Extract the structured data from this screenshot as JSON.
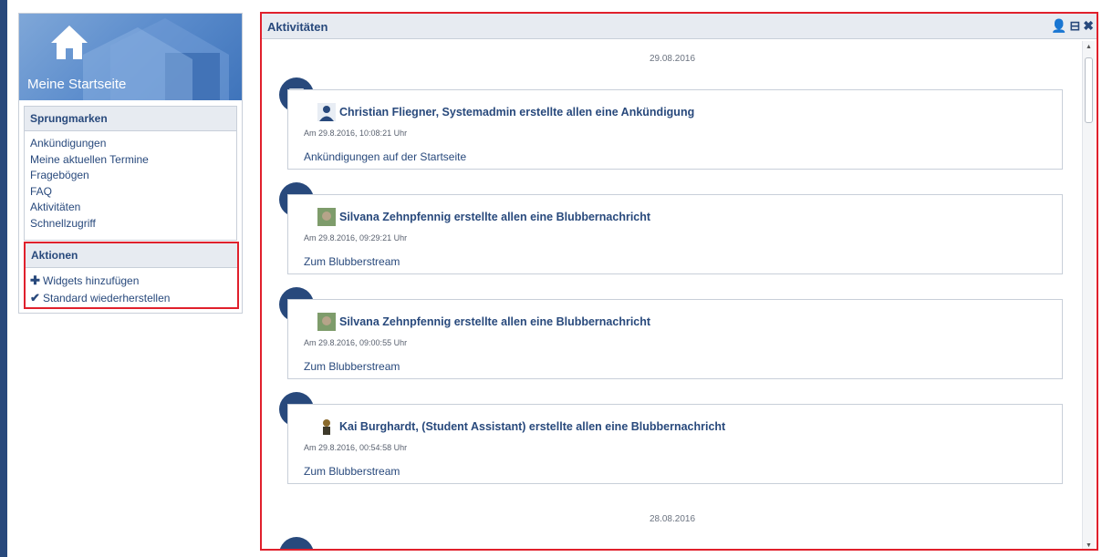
{
  "sidebar": {
    "title": "Meine Startseite",
    "jump": {
      "header": "Sprungmarken",
      "items": [
        "Ankündigungen",
        "Meine aktuellen Termine",
        "Fragebögen",
        "FAQ",
        "Aktivitäten",
        "Schnellzugriff"
      ]
    },
    "actions": {
      "header": "Aktionen",
      "items": [
        "Widgets hinzufügen",
        "Standard wiederherstellen"
      ]
    }
  },
  "main": {
    "title": "Aktivitäten",
    "dates": [
      "29.08.2016",
      "28.08.2016"
    ],
    "activities": [
      {
        "who": "Christian Fliegner, Systemadmin erstellte allen eine Ankündigung",
        "time": "Am 29.8.2016, 10:08:21 Uhr",
        "link": "Ankündigungen auf der Startseite",
        "icon": "announcement-icon"
      },
      {
        "who": "Silvana Zehnpfennig erstellte allen eine Blubbernachricht",
        "time": "Am 29.8.2016, 09:29:21 Uhr",
        "link": "Zum Blubberstream",
        "icon": "blubber-icon"
      },
      {
        "who": "Silvana Zehnpfennig erstellte allen eine Blubbernachricht",
        "time": "Am 29.8.2016, 09:00:55 Uhr",
        "link": "Zum Blubberstream",
        "icon": "blubber-icon"
      },
      {
        "who": "Kai Burghardt, (Student Assistant) erstellte allen eine Blubbernachricht",
        "time": "Am 29.8.2016, 00:54:58 Uhr",
        "link": "Zum Blubberstream",
        "icon": "blubber-icon"
      }
    ]
  },
  "colors": {
    "accent": "#28497c",
    "highlight": "#e0202c",
    "header_bg": "#e7ebf1"
  }
}
